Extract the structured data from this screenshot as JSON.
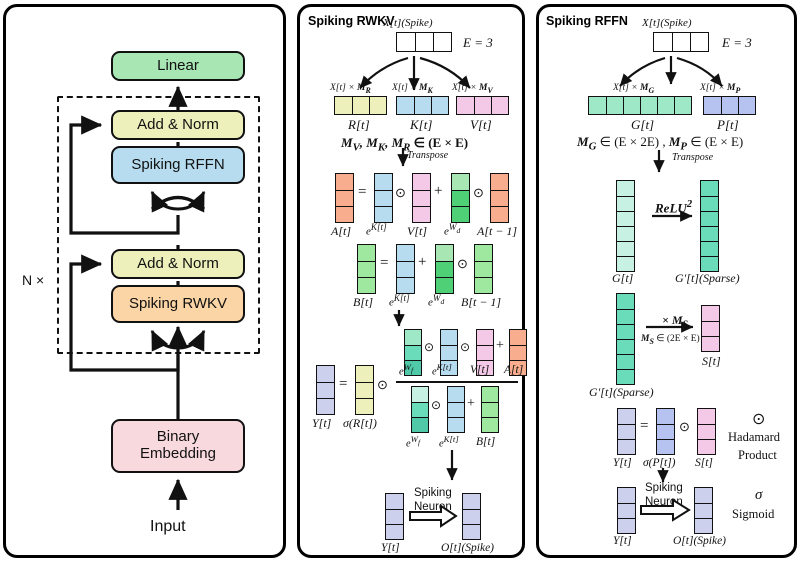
{
  "figure": {
    "title": "Spiking RWKV / Spiking RFFN architecture diagram",
    "colors": {
      "green": "#a8e6b4",
      "yellow": "#eef0bb",
      "blue": "#b7dcf0",
      "orange": "#fbd5a6",
      "pink_block": "#f7d9de",
      "salmon": "#f8ae8e",
      "lightgreen": "#9fe8a0",
      "magenta": "#f4c9e8",
      "teal": "#7fe3c6",
      "lavender": "#ccd0ec",
      "mint": "#9ee8c8",
      "periwinkle": "#b6c2ef",
      "white": "#ffffff"
    }
  },
  "left_panel": {
    "name": "architecture-overview",
    "blocks": {
      "linear": "Linear",
      "add_norm_top": "Add & Norm",
      "spiking_rffn": "Spiking RFFN",
      "add_norm_bottom": "Add & Norm",
      "spiking_rwkv": "Spiking RWKV",
      "binary_embedding": "Binary\nEmbedding",
      "binary_embedding_line1": "Binary",
      "binary_embedding_line2": "Embedding"
    },
    "repeat_label": "N ×",
    "input_label": "Input"
  },
  "mid_panel": {
    "title": "Spiking RWKV",
    "input": {
      "label": "X[t](Spike)",
      "dim": "E = 3",
      "cells": 3
    },
    "projections": [
      {
        "top": "X[t] × M_R",
        "bottom": "R[t]",
        "cells": 3,
        "color": "yellow"
      },
      {
        "top": "X[t] × M_K",
        "bottom": "K[t]",
        "cells": 3,
        "color": "blue"
      },
      {
        "top": "X[t] × M_V",
        "bottom": "V[t]",
        "cells": 3,
        "color": "magenta"
      }
    ],
    "matrix_note": "M_V, M_K, M_R ∈ (E × E)",
    "transpose_label": "Transpose",
    "eq_a": {
      "lhs": "A[t]",
      "terms": [
        "e^K[t]",
        "V[t]",
        "e^W_d",
        "A[t − 1]"
      ],
      "ops": [
        "=",
        "⊙",
        "+",
        "⊙"
      ]
    },
    "eq_b": {
      "lhs": "B[t]",
      "terms": [
        "e^K[t]",
        "e^W_d",
        "B[t − 1]"
      ],
      "ops": [
        "=",
        "+",
        "⊙"
      ]
    },
    "eq_y": {
      "lhs": "Y[t]",
      "factor": "σ(R[t])",
      "numerator": [
        "e^W_f",
        "e^K[t]",
        "V[t]",
        "A[t]"
      ],
      "denominator": [
        "e^W_f",
        "e^K[t]",
        "B[t]"
      ],
      "ops": [
        "=",
        "⊙",
        "⊙",
        "⊙",
        "+"
      ]
    },
    "spiking_neuron": {
      "label_line1": "Spiking",
      "label_line2": "Neuron",
      "input": "Y[t]",
      "output": "O[t](Spike)"
    }
  },
  "right_panel": {
    "title": "Spiking RFFN",
    "input": {
      "label": "X[t](Spike)",
      "dim": "E = 3",
      "cells": 3
    },
    "projections": [
      {
        "top": "X[t] × M_G",
        "bottom": "G[t]",
        "cells": 6,
        "color": "mint"
      },
      {
        "top": "X[t] × M_P",
        "bottom": "P[t]",
        "cells": 3,
        "color": "periwinkle"
      }
    ],
    "matrix_note": "M_G ∈ (E × 2E) , M_P ∈ (E × E)",
    "transpose_label": "Transpose",
    "relu_step": {
      "op": "ReLU²",
      "from": "G[t]",
      "to": "G′[t](Sparse)",
      "cells": 6
    },
    "ms_step": {
      "op": "× M_S",
      "note": "M_S ∈ (2E × E)",
      "from": "G′[t](Sparse)",
      "to": "S[t]",
      "from_cells": 6,
      "to_cells": 3
    },
    "eq_y": {
      "lhs": "Y[t]",
      "factor": "σ(P[t])",
      "rhs": "S[t]",
      "ops": [
        "=",
        "⊙"
      ]
    },
    "spiking_neuron": {
      "label_line1": "Spiking",
      "label_line2": "Neuron",
      "input": "Y[t]",
      "output": "O[t](Spike)"
    },
    "legend": [
      {
        "symbol": "⊙",
        "line1": "Hadamard",
        "line2": "Product"
      },
      {
        "symbol": "σ",
        "line1": "Sigmoid",
        "line2": ""
      }
    ]
  }
}
